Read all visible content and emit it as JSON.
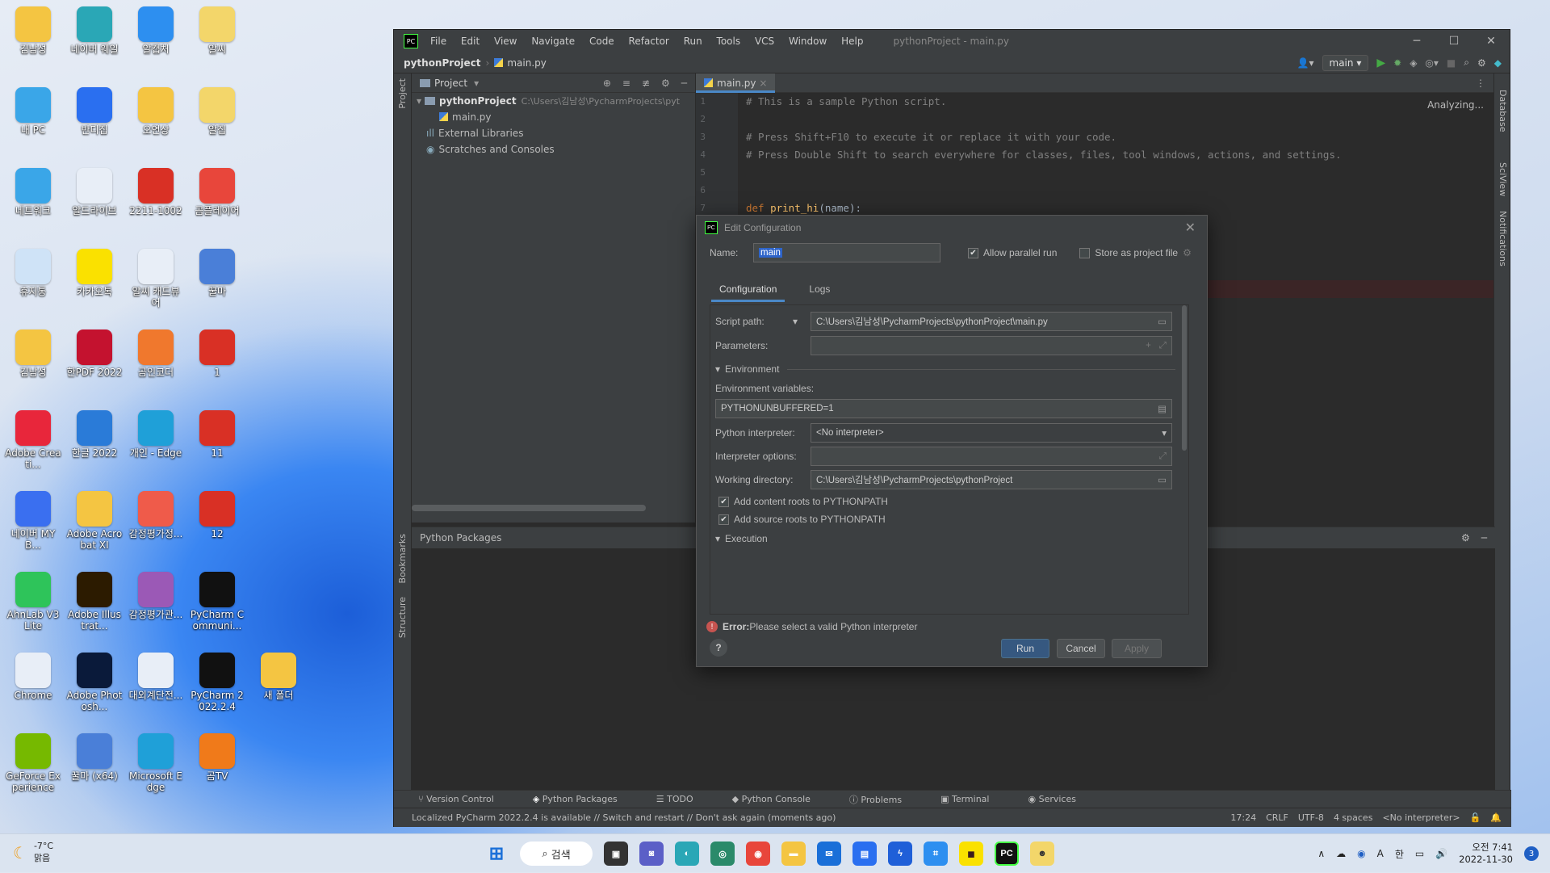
{
  "desktop_icons": [
    {
      "label": "김남성",
      "color": "#f4c542"
    },
    {
      "label": "네이버 웨일",
      "color": "#2aa7b6"
    },
    {
      "label": "알캡처",
      "color": "#2d8ff0"
    },
    {
      "label": "알씨",
      "color": "#f3d66a"
    },
    {
      "label": "내 PC",
      "color": "#3aa6e8"
    },
    {
      "label": "반디집",
      "color": "#2a6ff0"
    },
    {
      "label": "오연상",
      "color": "#f4c542"
    },
    {
      "label": "알집",
      "color": "#f3d66a"
    },
    {
      "label": "네트워크",
      "color": "#3aa6e8"
    },
    {
      "label": "알드라이브",
      "color": "#e8eef7"
    },
    {
      "label": "2211-1002",
      "color": "#d93025"
    },
    {
      "label": "곰플레이어",
      "color": "#e8463b"
    },
    {
      "label": "휴지통",
      "color": "#cfe3f7"
    },
    {
      "label": "카카오톡",
      "color": "#fae100"
    },
    {
      "label": "알씨 캐드뷰어",
      "color": "#e8eef7"
    },
    {
      "label": "꿀마",
      "color": "#4a7fd8"
    },
    {
      "label": "김남성",
      "color": "#f4c542"
    },
    {
      "label": "한PDF 2022",
      "color": "#c4122f"
    },
    {
      "label": "곰인코더",
      "color": "#f0782d"
    },
    {
      "label": "1",
      "color": "#d93025"
    },
    {
      "label": "Adobe Creati...",
      "color": "#e8263b"
    },
    {
      "label": "한글 2022",
      "color": "#2a7bd8"
    },
    {
      "label": "개인 - Edge",
      "color": "#1fa0d8"
    },
    {
      "label": "11",
      "color": "#d93025"
    },
    {
      "label": "네이버 MYB...",
      "color": "#3a6ff0"
    },
    {
      "label": "Adobe Acrobat XI",
      "color": "#f4c542"
    },
    {
      "label": "감정평가정...",
      "color": "#ef5b4a"
    },
    {
      "label": "12",
      "color": "#d93025"
    },
    {
      "label": "AhnLab V3 Lite",
      "color": "#2ec45a"
    },
    {
      "label": "Adobe Illustrat...",
      "color": "#2c1b00"
    },
    {
      "label": "감정평가관...",
      "color": "#9b59b6"
    },
    {
      "label": "PyCharm Communi...",
      "color": "#111111"
    },
    {
      "label": "Chrome",
      "color": "#e8eef7"
    },
    {
      "label": "Adobe Photosh...",
      "color": "#0a1a3a"
    },
    {
      "label": "대외계단전...",
      "color": "#e8eef7"
    },
    {
      "label": "PyCharm 2022.2.4",
      "color": "#111111"
    },
    {
      "label": "새 폴더",
      "color": "#f4c542"
    },
    {
      "label": "GeForce Experience",
      "color": "#76b900"
    },
    {
      "label": "꿀마 (x64)",
      "color": "#4a7fd8"
    },
    {
      "label": "Microsoft Edge",
      "color": "#1fa0d8"
    },
    {
      "label": "곰TV",
      "color": "#f07a1a"
    }
  ],
  "ide": {
    "logo": "PC",
    "menu": [
      "File",
      "Edit",
      "View",
      "Navigate",
      "Code",
      "Refactor",
      "Run",
      "Tools",
      "VCS",
      "Window",
      "Help"
    ],
    "title": "pythonProject - main.py",
    "breadcrumb": "pythonProject",
    "breadcrumb_file": "main.py",
    "run_config": "main",
    "project_header": "Project",
    "tree": {
      "root": "pythonProject",
      "root_path": "C:\\Users\\김남성\\PycharmProjects\\pyt",
      "file": "main.py",
      "ext": "External Libraries",
      "scratch": "Scratches and Consoles"
    },
    "editor_tab": "main.py",
    "analyzing": "Analyzing...",
    "gutter": [
      "1",
      "2",
      "3",
      "4",
      "5",
      "6",
      "7"
    ],
    "code": [
      "# This is a sample Python script.",
      "",
      "# Press Shift+F10 to execute it or replace it with your code.",
      "# Press Double Shift to search everywhere for classes, files, tool windows, actions, and settings.",
      "",
      "",
      "def print_hi(name):"
    ],
    "code_def_kw": "def",
    "code_def_fn": " print_hi",
    "code_def_rest": "(name):",
    "left_strip": {
      "project": "Project",
      "bookmarks": "Bookmarks",
      "structure": "Structure"
    },
    "right_strip": {
      "database": "Database",
      "sciview": "SciView",
      "notifications": "Notifications"
    },
    "bottom_panel_title": "Python Packages",
    "tool_tabs": [
      "Version Control",
      "Python Packages",
      "TODO",
      "Python Console",
      "Problems",
      "Terminal",
      "Services"
    ],
    "status": "Localized PyCharm 2022.2.4 is available // Switch and restart // Don't ask again (moments ago)",
    "status_right": [
      "17:24",
      "CRLF",
      "UTF-8",
      "4 spaces",
      "<No interpreter>"
    ]
  },
  "dialog": {
    "title": "Edit Configuration",
    "name_label": "Name:",
    "name_value": "main",
    "allow_parallel": "Allow parallel run",
    "store_project": "Store as project file",
    "tab_config": "Configuration",
    "tab_logs": "Logs",
    "script_path_label": "Script path:",
    "script_path": "C:\\Users\\김남성\\PycharmProjects\\pythonProject\\main.py",
    "params_label": "Parameters:",
    "environment": "Environment",
    "env_vars_label": "Environment variables:",
    "env_vars": "PYTHONUNBUFFERED=1",
    "interp_label": "Python interpreter:",
    "interp_value": "<No interpreter>",
    "interp_opts_label": "Interpreter options:",
    "workdir_label": "Working directory:",
    "workdir": "C:\\Users\\김남성\\PycharmProjects\\pythonProject",
    "content_roots": "Add content roots to PYTHONPATH",
    "source_roots": "Add source roots to PYTHONPATH",
    "execution": "Execution",
    "error_bold": "Error:",
    "error_msg": " Please select a valid Python interpreter",
    "run": "Run",
    "cancel": "Cancel",
    "apply": "Apply",
    "help": "?"
  },
  "taskbar": {
    "temp": "-7°C",
    "weather": "맑음",
    "search": "검색",
    "ime": "A",
    "lang": "한",
    "time": "오전 7:41",
    "date": "2022-11-30",
    "notifications": "3"
  }
}
